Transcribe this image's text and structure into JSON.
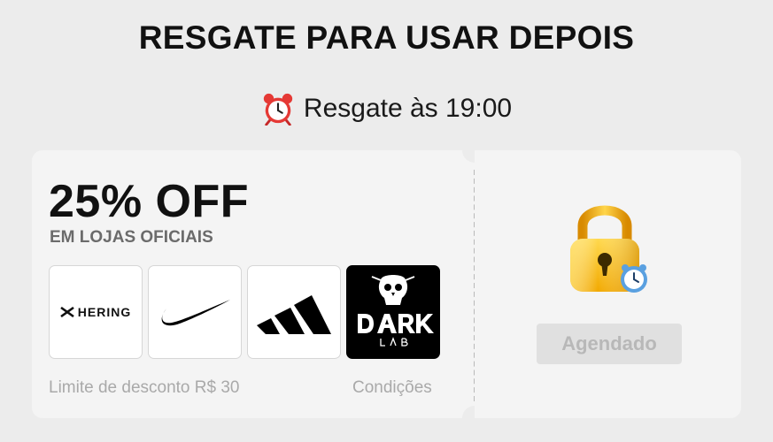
{
  "header": {
    "title": "RESGATE PARA USAR DEPOIS",
    "redeem_time_label": "Resgate às 19:00",
    "clock_icon": "alarm-clock-icon"
  },
  "coupon": {
    "discount": "25% OFF",
    "subtitle": "EM LOJAS OFICIAIS",
    "brands": [
      {
        "name": "HERING",
        "icon": "hering-logo"
      },
      {
        "icon": "nike-swoosh-logo"
      },
      {
        "icon": "adidas-logo"
      },
      {
        "icon": "dark-lab-logo"
      }
    ],
    "limit_text": "Limite de desconto R$ 30",
    "conditions_link": "Condições",
    "status_label": "Agendado",
    "status_icon": "lock-with-clock-icon"
  },
  "colors": {
    "background": "#ececec",
    "card": "#f4f4f4",
    "lock_gold": "#f4b400",
    "muted_text": "#a9a9a9"
  }
}
